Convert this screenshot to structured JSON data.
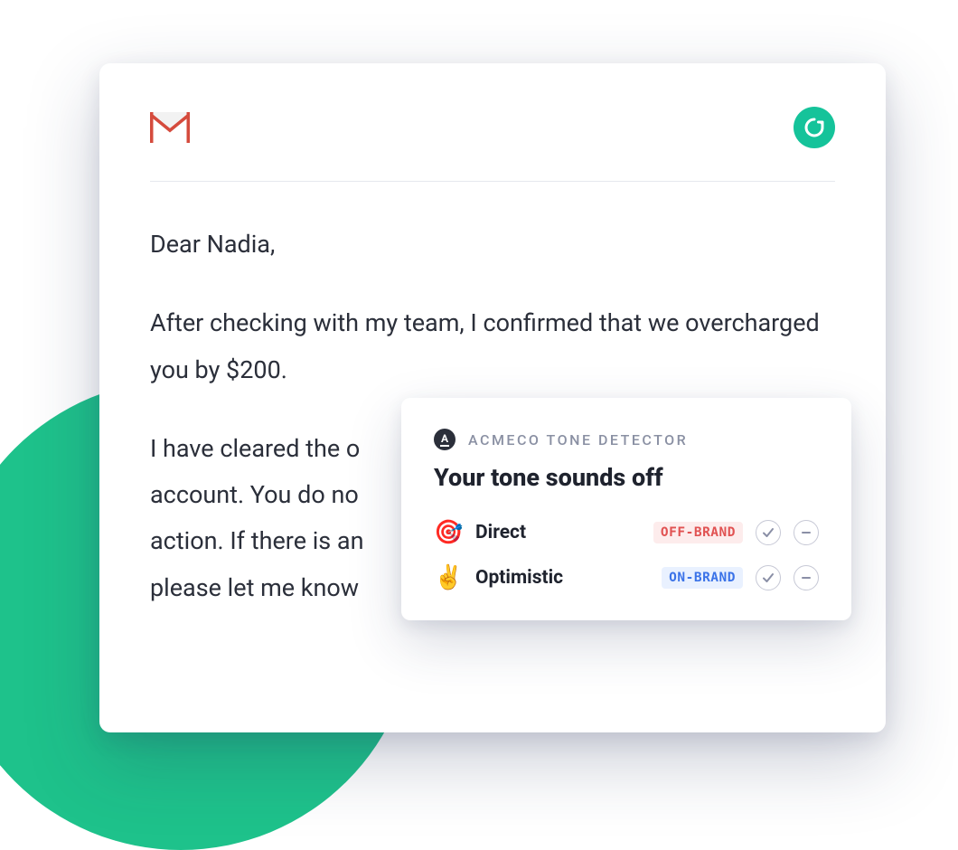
{
  "email": {
    "greeting": "Dear Nadia,",
    "paragraph1": "After checking with my team, I confirmed that we overcharged you by $200.",
    "paragraph2_truncated": "I have cleared the o\naccount. You do no\naction. If there is an\nplease let me know"
  },
  "tone": {
    "brand_label": "ACMECO TONE DETECTOR",
    "title": "Your tone sounds off",
    "rows": [
      {
        "emoji": "🎯",
        "label": "Direct",
        "badge": "OFF-BRAND",
        "badge_class": "off"
      },
      {
        "emoji": "✌️",
        "label": "Optimistic",
        "badge": "ON-BRAND",
        "badge_class": "on"
      }
    ]
  },
  "icons": {
    "gmail": "gmail-icon",
    "grammarly": "grammarly-icon",
    "brand_a": "A"
  }
}
